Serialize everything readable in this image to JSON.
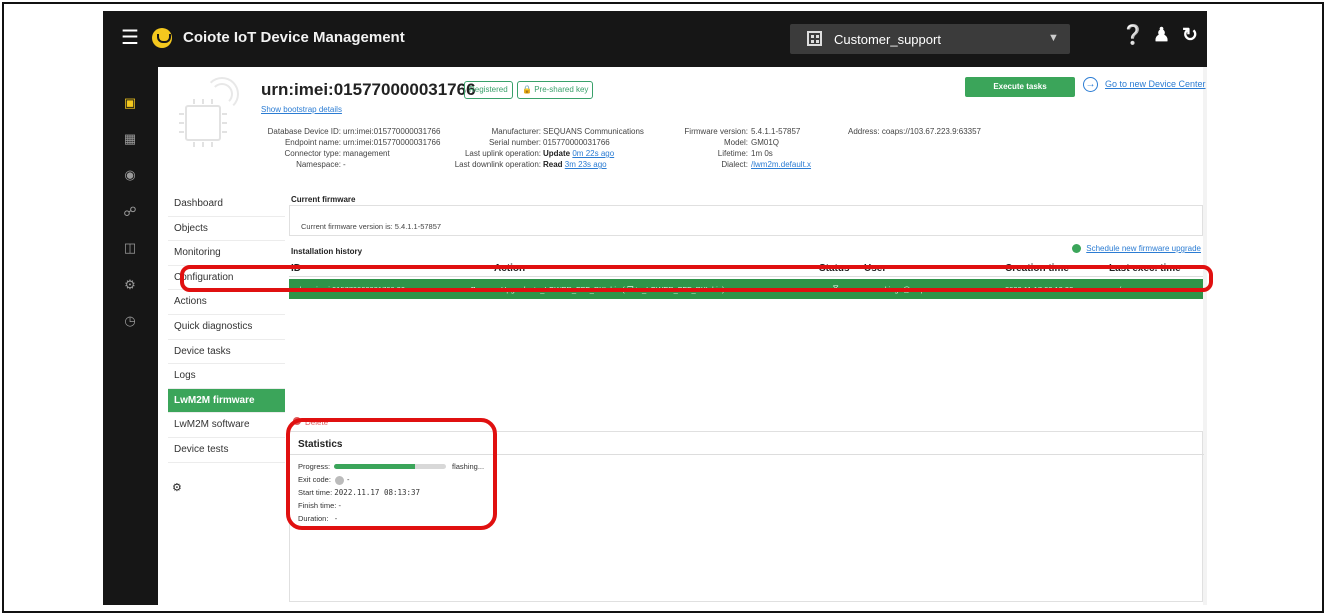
{
  "header": {
    "app_title": "Coiote IoT Device Management",
    "tenant": "Customer_support"
  },
  "device": {
    "title": "urn:imei:015770000031766",
    "badge_registered": "Registered",
    "badge_psk": "Pre-shared key",
    "show_bootstrap": "Show bootstrap details",
    "execute_tasks": "Execute tasks",
    "go_to_center": "Go to new Device Center",
    "col1_labels": [
      "Database Device ID:",
      "Endpoint name:",
      "Connector type:",
      "Namespace:"
    ],
    "col1_values": [
      "urn:imei:015770000031766",
      "urn:imei:015770000031766",
      "management",
      "-"
    ],
    "col2_labels": [
      "Manufacturer:",
      "Serial number:",
      "Last uplink operation:",
      "Last downlink operation:"
    ],
    "col2_values": [
      "SEQUANS Communications",
      "015770000031766",
      "Update",
      "Read"
    ],
    "col2_links": [
      "",
      "",
      "0m 22s ago",
      "3m 23s ago"
    ],
    "col3_labels": [
      "Firmware version:",
      "Model:",
      "Lifetime:",
      "Dialect:"
    ],
    "col3_values": [
      "5.4.1.1-57857",
      "GM01Q",
      "1m 0s",
      ""
    ],
    "dialect_link": "/lwm2m.default.x",
    "address_label": "Address:",
    "address_value": "coaps://103.67.223.9:63357"
  },
  "nav": {
    "items": [
      "Dashboard",
      "Objects",
      "Monitoring",
      "Configuration",
      "Actions",
      "Quick diagnostics",
      "Device tasks",
      "Logs",
      "LwM2M firmware",
      "LwM2M software",
      "Device tests"
    ],
    "active": "LwM2M firmware"
  },
  "firmware": {
    "current_heading": "Current firmware",
    "current_text": "Current firmware version is: 5.4.1.1-57857",
    "history_heading": "Installation history",
    "schedule_link": "Schedule new firmware upgrade",
    "columns": [
      "ID",
      "Action",
      "Status",
      "User",
      "Creation time",
      "Last exec. time"
    ],
    "row": {
      "id": "d:urn:imei:015770000031766:20",
      "pause": "II",
      "action": "Upgrade: to_LOWER_FFF_PXL.bin ( ❒ to_LOWER_FFF_PXL.bin)",
      "status": "→ ⧖",
      "user": "ccookinge@sequans.com",
      "creation": "2022.11.17 08:13:32",
      "last_exec": "n/a"
    },
    "delete_label": "Delete"
  },
  "statistics": {
    "heading": "Statistics",
    "progress_label": "Progress:",
    "progress_fraction": 0.72,
    "progress_status": "flashing...",
    "exit_code_label": "Exit code:",
    "exit_code_value": "-",
    "start_label": "Start time:",
    "start_value": "2022.11.17 08:13:37",
    "finish_label": "Finish time:",
    "finish_value": "-",
    "duration_label": "Duration:",
    "duration_value": "-"
  },
  "colors": {
    "accent": "#3ba55a",
    "topbar": "#161616",
    "highlight": "#e01010"
  }
}
